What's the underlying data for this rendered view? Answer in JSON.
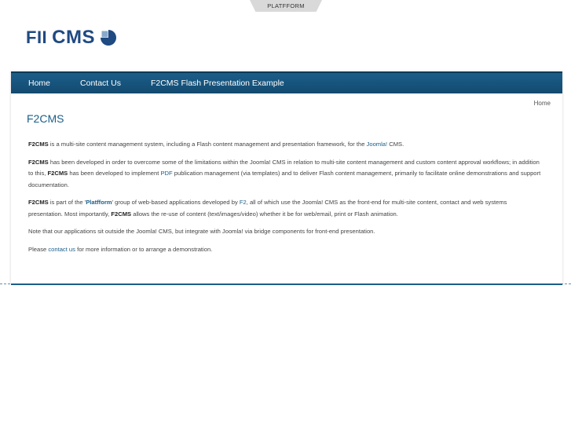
{
  "header": {
    "top_tab": "PLATFFORM",
    "logo_text_a": "FII",
    "logo_text_b": "CMS",
    "brand_color": "#1f4a82"
  },
  "nav": {
    "items": [
      "Home",
      "Contact Us",
      "F2CMS Flash Presentation Example"
    ]
  },
  "breadcrumb": "Home",
  "page_title": "F2CMS",
  "paragraphs": {
    "p1": {
      "b1": "F2CMS",
      "t1": " is a multi-site content management system, including a Flash content management and presentation framework, for the ",
      "a1": "Joomla!",
      "t2": " CMS."
    },
    "p2": {
      "b1": "F2CMS",
      "t1": " has been developed in order to overcome some of the limitations within the Joomla! CMS in relation to multi-site content management and custom content approval workflows; in addition to this, ",
      "b2": "F2CMS",
      "t2": " has been developed to implement ",
      "a1": "PDF",
      "t3": " publication management (via templates) and to deliver Flash content management, primarily to facilitate online demonstrations and support documentation."
    },
    "p3": {
      "b1": "F2CMS",
      "t1": " is part of the '",
      "a1": "Platfform",
      "t2": "' group of web-based applications developed by ",
      "a2": "F2",
      "t3": ", all of which use the Joomla! CMS as the front-end for multi-site content, contact and web systems presentation. Most importantly, ",
      "b2": "F2CMS",
      "t4": " allows the re-use of content (text/images/video) whether it be for web/email, print or Flash animation."
    },
    "p4": {
      "t1": "Note that our applications sit outside the Joomla! CMS, but integrate with Joomla! via bridge components for front-end presentation."
    },
    "p5": {
      "t1": "Please ",
      "a1": "contact us",
      "t2": " for more information or to arrange a demonstration."
    }
  },
  "colors": {
    "nav_bg": "#1b5e8a",
    "link": "#1b5e8a",
    "title": "#1b5e8a"
  }
}
